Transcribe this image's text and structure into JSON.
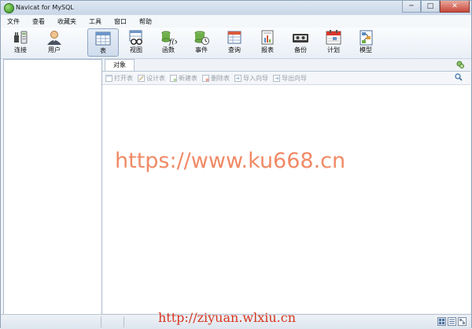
{
  "window": {
    "title": "Navicat for MySQL"
  },
  "titlebar_buttons": {
    "minimize": "─",
    "maximize": "□",
    "close": "✕"
  },
  "menu": [
    "文件",
    "查看",
    "收藏夹",
    "工具",
    "窗口",
    "帮助"
  ],
  "toolbar": [
    {
      "label": "连接",
      "icon": "connection-plug-icon"
    },
    {
      "label": "用户",
      "icon": "user-icon"
    },
    {
      "label": "表",
      "icon": "table-icon",
      "active": true
    },
    {
      "label": "视图",
      "icon": "view-glasses-icon"
    },
    {
      "label": "函数",
      "icon": "function-icon"
    },
    {
      "label": "事件",
      "icon": "event-clock-icon"
    },
    {
      "label": "查询",
      "icon": "query-icon"
    },
    {
      "label": "报表",
      "icon": "report-icon"
    },
    {
      "label": "备份",
      "icon": "backup-tape-icon"
    },
    {
      "label": "计划",
      "icon": "schedule-calendar-icon"
    },
    {
      "label": "模型",
      "icon": "model-icon"
    }
  ],
  "object_tab": {
    "label": "对象"
  },
  "object_toolbar": [
    {
      "label": "打开表",
      "icon": "open-table-icon"
    },
    {
      "label": "设计表",
      "icon": "design-table-icon"
    },
    {
      "label": "新建表",
      "icon": "new-table-icon"
    },
    {
      "label": "删除表",
      "icon": "delete-table-icon"
    },
    {
      "label": "导入向导",
      "icon": "import-wizard-icon"
    },
    {
      "label": "导出向导",
      "icon": "export-wizard-icon"
    }
  ],
  "watermarks": {
    "center": "https://www.ku668.cn",
    "bottom": "http://ziyuan.wlxiu.cn"
  },
  "colors": {
    "accent": "#2f8a1c",
    "watermark_center": "#f08a66",
    "watermark_bottom": "#d9351e"
  }
}
